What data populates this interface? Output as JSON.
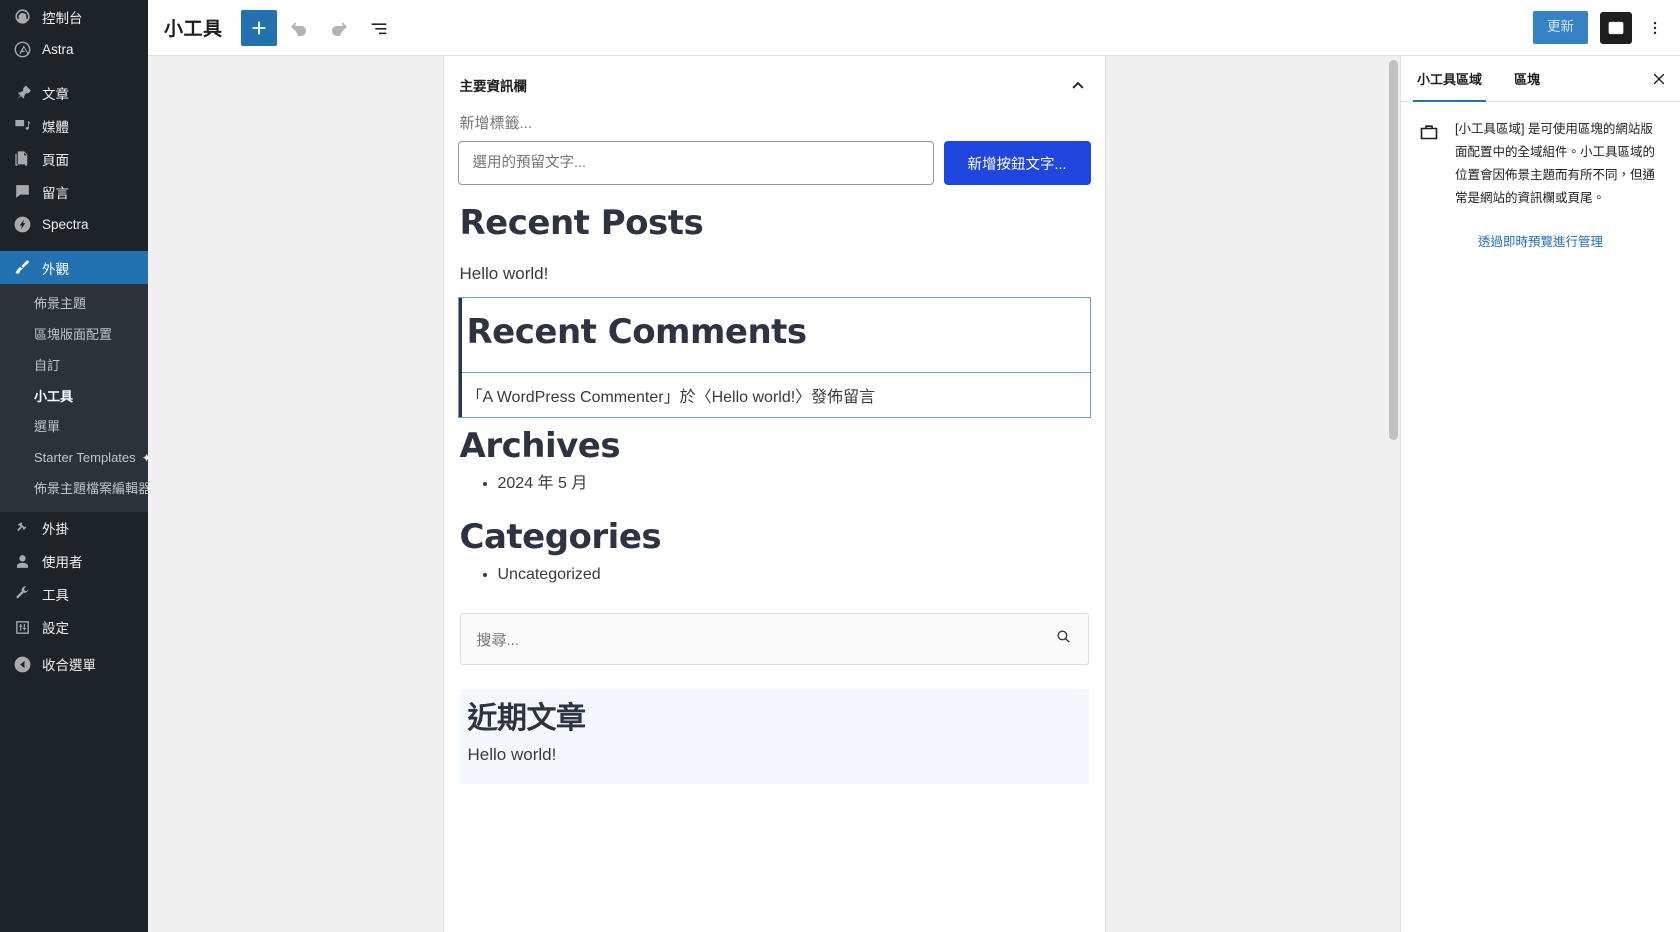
{
  "admin_menu": {
    "items": [
      {
        "label": "控制台",
        "icon": "dashboard-icon"
      },
      {
        "label": "Astra",
        "icon": "astra-logo-icon"
      },
      {
        "label": "文章",
        "icon": "pin-icon"
      },
      {
        "label": "媒體",
        "icon": "media-icon"
      },
      {
        "label": "頁面",
        "icon": "pages-icon"
      },
      {
        "label": "留言",
        "icon": "comments-icon"
      },
      {
        "label": "Spectra",
        "icon": "spectra-icon"
      },
      {
        "label": "外觀",
        "icon": "appearance-brush-icon"
      },
      {
        "label": "外掛",
        "icon": "plugins-icon"
      },
      {
        "label": "使用者",
        "icon": "users-icon"
      },
      {
        "label": "工具",
        "icon": "tools-wrench-icon"
      },
      {
        "label": "設定",
        "icon": "settings-icon"
      }
    ],
    "appearance_submenu": [
      "佈景主題",
      "區塊版面配置",
      "自訂",
      "小工具",
      "選單",
      "Starter Templates",
      "佈景主題檔案編輯器"
    ],
    "appearance_submenu_active": "小工具",
    "collapse_label": "收合選單"
  },
  "header": {
    "title": "小工具",
    "add_block_label": "+",
    "undo_label": "復原",
    "redo_label": "重做",
    "list_view_label": "文件概觀",
    "update_label": "更新",
    "settings_toggle_label": "設定",
    "options_label": "選項"
  },
  "canvas": {
    "widget_area_title": "主要資訊欄",
    "collapse_icon": "chevron-up-icon",
    "search_block": {
      "add_label": "新增標籤...",
      "input_placeholder": "選用的預留文字...",
      "button_label": "新增按鈕文字..."
    },
    "blocks": [
      {
        "type": "heading",
        "text": "Recent Posts"
      },
      {
        "type": "paragraph",
        "text": "Hello world!"
      }
    ],
    "selected_block": {
      "heading": "Recent Comments",
      "items": [
        "「A WordPress Commenter」於〈Hello world!〉發佈留言"
      ]
    },
    "archives": {
      "heading": "Archives",
      "items": [
        "2024 年 5 月"
      ]
    },
    "categories": {
      "heading": "Categories",
      "items": [
        "Uncategorized"
      ]
    },
    "search_preview": {
      "placeholder": "搜尋...",
      "icon": "search-icon"
    },
    "recent_zh": {
      "heading": "近期文章",
      "item": "Hello world!"
    }
  },
  "side_panel": {
    "tabs": [
      {
        "label": "小工具區域",
        "active": true
      },
      {
        "label": "區塊",
        "active": false
      }
    ],
    "close_label": "關閉設定",
    "panel_icon": "widget-area-icon",
    "description": "[小工具區域] 是可使用區塊的網站版面配置中的全域組件。小工具區域的位置會因佈景主題而有所不同，但通常是網站的資訊欄或頁尾。",
    "manage_link": "透過即時預覽進行管理"
  },
  "colors": {
    "admin_bg": "#1d2327",
    "admin_submenu_bg": "#2c3338",
    "accent_blue": "#2271b1",
    "button_blue": "#2046e0",
    "update_blue": "#3582c4",
    "heading_navy": "#2e3342",
    "selected_border": "#6a9fc4"
  }
}
